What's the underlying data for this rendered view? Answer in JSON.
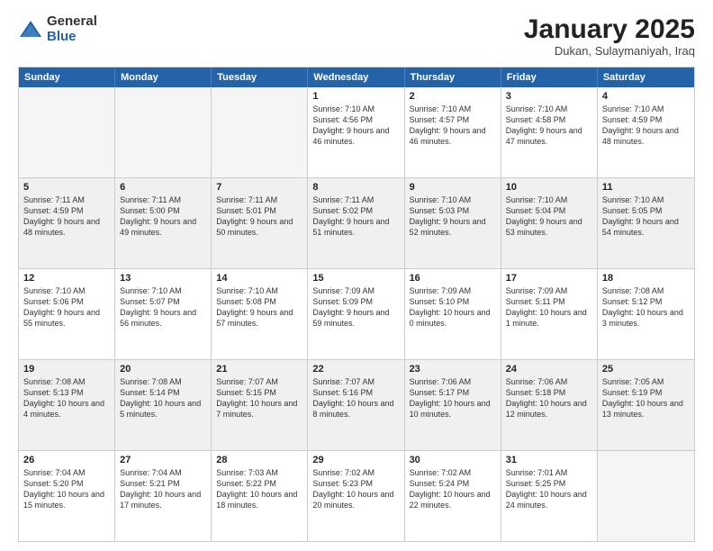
{
  "logo": {
    "general": "General",
    "blue": "Blue"
  },
  "title": "January 2025",
  "subtitle": "Dukan, Sulaymaniyah, Iraq",
  "days": [
    "Sunday",
    "Monday",
    "Tuesday",
    "Wednesday",
    "Thursday",
    "Friday",
    "Saturday"
  ],
  "weeks": [
    [
      {
        "day": "",
        "info": ""
      },
      {
        "day": "",
        "info": ""
      },
      {
        "day": "",
        "info": ""
      },
      {
        "day": "1",
        "info": "Sunrise: 7:10 AM\nSunset: 4:56 PM\nDaylight: 9 hours and 46 minutes."
      },
      {
        "day": "2",
        "info": "Sunrise: 7:10 AM\nSunset: 4:57 PM\nDaylight: 9 hours and 46 minutes."
      },
      {
        "day": "3",
        "info": "Sunrise: 7:10 AM\nSunset: 4:58 PM\nDaylight: 9 hours and 47 minutes."
      },
      {
        "day": "4",
        "info": "Sunrise: 7:10 AM\nSunset: 4:59 PM\nDaylight: 9 hours and 48 minutes."
      }
    ],
    [
      {
        "day": "5",
        "info": "Sunrise: 7:11 AM\nSunset: 4:59 PM\nDaylight: 9 hours and 48 minutes."
      },
      {
        "day": "6",
        "info": "Sunrise: 7:11 AM\nSunset: 5:00 PM\nDaylight: 9 hours and 49 minutes."
      },
      {
        "day": "7",
        "info": "Sunrise: 7:11 AM\nSunset: 5:01 PM\nDaylight: 9 hours and 50 minutes."
      },
      {
        "day": "8",
        "info": "Sunrise: 7:11 AM\nSunset: 5:02 PM\nDaylight: 9 hours and 51 minutes."
      },
      {
        "day": "9",
        "info": "Sunrise: 7:10 AM\nSunset: 5:03 PM\nDaylight: 9 hours and 52 minutes."
      },
      {
        "day": "10",
        "info": "Sunrise: 7:10 AM\nSunset: 5:04 PM\nDaylight: 9 hours and 53 minutes."
      },
      {
        "day": "11",
        "info": "Sunrise: 7:10 AM\nSunset: 5:05 PM\nDaylight: 9 hours and 54 minutes."
      }
    ],
    [
      {
        "day": "12",
        "info": "Sunrise: 7:10 AM\nSunset: 5:06 PM\nDaylight: 9 hours and 55 minutes."
      },
      {
        "day": "13",
        "info": "Sunrise: 7:10 AM\nSunset: 5:07 PM\nDaylight: 9 hours and 56 minutes."
      },
      {
        "day": "14",
        "info": "Sunrise: 7:10 AM\nSunset: 5:08 PM\nDaylight: 9 hours and 57 minutes."
      },
      {
        "day": "15",
        "info": "Sunrise: 7:09 AM\nSunset: 5:09 PM\nDaylight: 9 hours and 59 minutes."
      },
      {
        "day": "16",
        "info": "Sunrise: 7:09 AM\nSunset: 5:10 PM\nDaylight: 10 hours and 0 minutes."
      },
      {
        "day": "17",
        "info": "Sunrise: 7:09 AM\nSunset: 5:11 PM\nDaylight: 10 hours and 1 minute."
      },
      {
        "day": "18",
        "info": "Sunrise: 7:08 AM\nSunset: 5:12 PM\nDaylight: 10 hours and 3 minutes."
      }
    ],
    [
      {
        "day": "19",
        "info": "Sunrise: 7:08 AM\nSunset: 5:13 PM\nDaylight: 10 hours and 4 minutes."
      },
      {
        "day": "20",
        "info": "Sunrise: 7:08 AM\nSunset: 5:14 PM\nDaylight: 10 hours and 5 minutes."
      },
      {
        "day": "21",
        "info": "Sunrise: 7:07 AM\nSunset: 5:15 PM\nDaylight: 10 hours and 7 minutes."
      },
      {
        "day": "22",
        "info": "Sunrise: 7:07 AM\nSunset: 5:16 PM\nDaylight: 10 hours and 8 minutes."
      },
      {
        "day": "23",
        "info": "Sunrise: 7:06 AM\nSunset: 5:17 PM\nDaylight: 10 hours and 10 minutes."
      },
      {
        "day": "24",
        "info": "Sunrise: 7:06 AM\nSunset: 5:18 PM\nDaylight: 10 hours and 12 minutes."
      },
      {
        "day": "25",
        "info": "Sunrise: 7:05 AM\nSunset: 5:19 PM\nDaylight: 10 hours and 13 minutes."
      }
    ],
    [
      {
        "day": "26",
        "info": "Sunrise: 7:04 AM\nSunset: 5:20 PM\nDaylight: 10 hours and 15 minutes."
      },
      {
        "day": "27",
        "info": "Sunrise: 7:04 AM\nSunset: 5:21 PM\nDaylight: 10 hours and 17 minutes."
      },
      {
        "day": "28",
        "info": "Sunrise: 7:03 AM\nSunset: 5:22 PM\nDaylight: 10 hours and 18 minutes."
      },
      {
        "day": "29",
        "info": "Sunrise: 7:02 AM\nSunset: 5:23 PM\nDaylight: 10 hours and 20 minutes."
      },
      {
        "day": "30",
        "info": "Sunrise: 7:02 AM\nSunset: 5:24 PM\nDaylight: 10 hours and 22 minutes."
      },
      {
        "day": "31",
        "info": "Sunrise: 7:01 AM\nSunset: 5:25 PM\nDaylight: 10 hours and 24 minutes."
      },
      {
        "day": "",
        "info": ""
      }
    ]
  ]
}
